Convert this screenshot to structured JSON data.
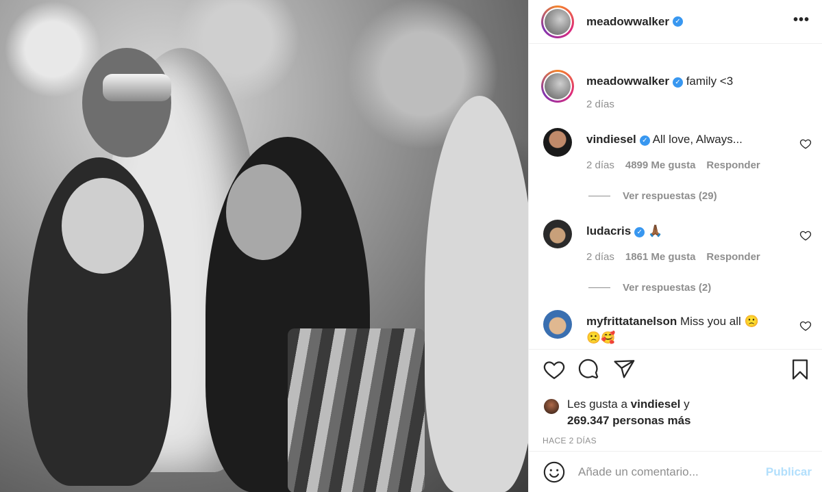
{
  "post": {
    "username": "meadowwalker",
    "caption": "family <3",
    "caption_time": "2 días"
  },
  "comments": [
    {
      "username": "vindiesel",
      "verified": true,
      "text": "All love, Always...",
      "time": "2 días",
      "likes": "4899 Me gusta",
      "reply": "Responder",
      "view_replies": "Ver respuestas (29)"
    },
    {
      "username": "ludacris",
      "verified": true,
      "text": "🙏🏾",
      "time": "2 días",
      "likes": "1861 Me gusta",
      "reply": "Responder",
      "view_replies": "Ver respuestas (2)"
    },
    {
      "username": "myfrittatanelson",
      "verified": false,
      "text": "Miss you all 🙁",
      "text2": "🙁🥰"
    }
  ],
  "likes": {
    "prefix": "Les gusta a",
    "user": "vindiesel",
    "suffix": "y",
    "count": "269.347 personas más"
  },
  "posted_ago": "HACE 2 DÍAS",
  "composer": {
    "placeholder": "Añade un comentario...",
    "post_label": "Publicar"
  },
  "colors": {
    "verified": "#3897f0",
    "muted": "#8e8e8e",
    "post_disabled": "#b2dffc"
  }
}
